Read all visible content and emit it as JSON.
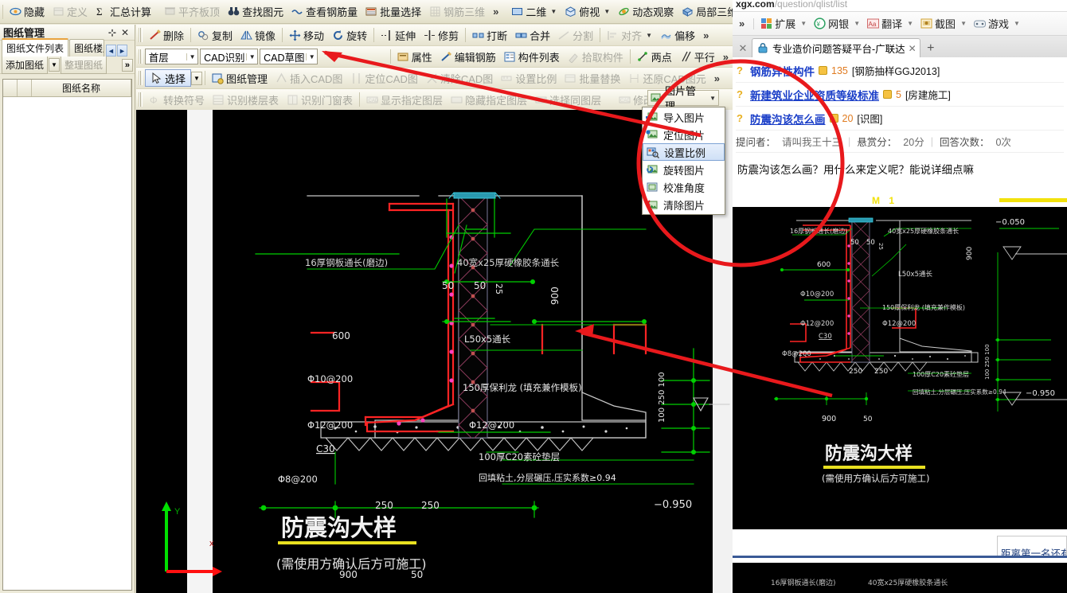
{
  "app": {
    "ribbon_top": [
      {
        "label": "隐藏",
        "icon": "eye-icon",
        "disabled": false
      },
      {
        "label": "定义",
        "icon": "define-icon",
        "disabled": true
      },
      {
        "label": "汇总计算",
        "icon": "sigma-icon",
        "disabled": false
      },
      {
        "label": "平齐板顶",
        "icon": "align-slab-icon",
        "disabled": true
      },
      {
        "label": "查找图元",
        "icon": "binoculars-icon",
        "disabled": false
      },
      {
        "label": "查看钢筋量",
        "icon": "rebar-qty-icon",
        "disabled": false
      },
      {
        "label": "批量选择",
        "icon": "batch-select-icon",
        "disabled": false
      },
      {
        "label": "钢筋三维",
        "icon": "rebar-3d-icon",
        "disabled": true
      }
    ],
    "ribbon_top_right": [
      {
        "label": "二维",
        "icon": "view-2d-icon",
        "caret": true
      },
      {
        "label": "俯视",
        "icon": "top-view-icon",
        "caret": true
      },
      {
        "label": "动态观察",
        "icon": "orbit-icon",
        "caret": false
      },
      {
        "label": "局部三维",
        "icon": "local-3d-icon",
        "caret": false
      }
    ],
    "toolbar_row1": [
      {
        "label": "删除",
        "icon": "delete-icon",
        "disabled": false
      },
      {
        "label": "复制",
        "icon": "copy-icon",
        "disabled": false
      },
      {
        "label": "镜像",
        "icon": "mirror-icon",
        "disabled": false
      },
      {
        "label": "移动",
        "icon": "move-icon",
        "disabled": false
      },
      {
        "label": "旋转",
        "icon": "rotate-icon",
        "disabled": false
      },
      {
        "label": "延伸",
        "icon": "extend-icon",
        "disabled": false
      },
      {
        "label": "修剪",
        "icon": "trim-icon",
        "disabled": false
      },
      {
        "label": "打断",
        "icon": "break-icon",
        "disabled": false
      },
      {
        "label": "合并",
        "icon": "merge-icon",
        "disabled": false
      },
      {
        "label": "分割",
        "icon": "split-icon",
        "disabled": true
      },
      {
        "label": "对齐",
        "icon": "align-icon",
        "disabled": true,
        "caret": true
      },
      {
        "label": "偏移",
        "icon": "offset-icon",
        "disabled": false
      }
    ],
    "toolbar_row2_combos": [
      {
        "value": "首层"
      },
      {
        "value": "CAD识别"
      },
      {
        "value": "CAD草图"
      }
    ],
    "toolbar_row2": [
      {
        "label": "属性",
        "icon": "properties-icon",
        "disabled": false
      },
      {
        "label": "编辑钢筋",
        "icon": "edit-rebar-icon",
        "disabled": false
      },
      {
        "label": "构件列表",
        "icon": "component-list-icon",
        "disabled": false
      },
      {
        "label": "拾取构件",
        "icon": "pick-component-icon",
        "disabled": true
      },
      {
        "label": "两点",
        "icon": "two-point-icon",
        "disabled": false
      },
      {
        "label": "平行",
        "icon": "parallel-icon",
        "disabled": false
      }
    ],
    "toolbar_row3_select": {
      "label": "选择",
      "icon": "arrow-select-icon"
    },
    "toolbar_row3": [
      {
        "label": "图纸管理",
        "icon": "drawing-manage-icon",
        "disabled": false
      },
      {
        "label": "插入CAD图",
        "icon": "insert-cad-icon",
        "disabled": true
      },
      {
        "label": "定位CAD图",
        "icon": "locate-cad-icon",
        "disabled": true
      },
      {
        "label": "清除CAD图",
        "icon": "clear-cad-icon",
        "disabled": true
      },
      {
        "label": "设置比例",
        "icon": "set-scale-icon",
        "disabled": true
      },
      {
        "label": "批量替换",
        "icon": "batch-replace-icon",
        "disabled": true
      },
      {
        "label": "还原CAD图元",
        "icon": "restore-cad-icon",
        "disabled": true
      }
    ],
    "toolbar_row4": [
      {
        "label": "转换符号",
        "icon": "convert-symbol-icon",
        "disabled": true
      },
      {
        "label": "识别楼层表",
        "icon": "recognize-floor-table-icon",
        "disabled": true
      },
      {
        "label": "识别门窗表",
        "icon": "recognize-door-window-icon",
        "disabled": true
      },
      {
        "label": "显示指定图层",
        "icon": "show-layer-icon",
        "disabled": true
      },
      {
        "label": "隐藏指定图层",
        "icon": "hide-layer-icon",
        "disabled": true
      },
      {
        "label": "选择同图层",
        "icon": "select-same-layer-icon",
        "disabled": true
      },
      {
        "label": "修改CAD标注",
        "icon": "modify-cad-dim-icon",
        "disabled": true
      }
    ],
    "picture_manage": {
      "button_label": "图片管理",
      "menu": [
        {
          "label": "导入图片",
          "icon": "import-image-icon",
          "highlighted": false
        },
        {
          "label": "定位图片",
          "icon": "locate-image-icon",
          "highlighted": false
        },
        {
          "label": "设置比例",
          "icon": "set-scale-image-icon",
          "highlighted": true
        },
        {
          "label": "旋转图片",
          "icon": "rotate-image-icon",
          "highlighted": false
        },
        {
          "label": "校准角度",
          "icon": "calibrate-angle-icon",
          "highlighted": false
        },
        {
          "label": "清除图片",
          "icon": "clear-image-icon",
          "highlighted": false
        }
      ]
    },
    "dock": {
      "title": "图纸管理",
      "pin_icon": "pin-icon",
      "close_icon": "close-icon",
      "tabs": [
        {
          "label": "图纸文件列表",
          "active": true
        },
        {
          "label": "图纸楼层",
          "active": false
        }
      ],
      "nav_prev": "◄",
      "nav_next": "►",
      "buttons": [
        {
          "label": "添加图纸",
          "disabled": false,
          "caret": true
        },
        {
          "label": "整理图纸",
          "disabled": true,
          "caret": false
        }
      ],
      "more_label": "»",
      "grid_header": "图纸名称"
    }
  },
  "cad": {
    "title": "防震沟大样",
    "subtitle": "(需使用方确认后方可施工)",
    "annotations": [
      {
        "text": "16厚钢板通长(磨边)"
      },
      {
        "text": "40宽x25厚硬橡胶条通长"
      },
      {
        "text": "50"
      },
      {
        "text": "50"
      },
      {
        "text": "25"
      },
      {
        "text": "600"
      },
      {
        "text": "L50x5通长"
      },
      {
        "text": "Φ10@200"
      },
      {
        "text": "150厚保利龙 (填充兼作模板)"
      },
      {
        "text": "Φ12@200"
      },
      {
        "text": "Φ12@200"
      },
      {
        "text": "C30"
      },
      {
        "text": "900"
      },
      {
        "text": "Φ8@200"
      },
      {
        "text": "250"
      },
      {
        "text": "250"
      },
      {
        "text": "900"
      },
      {
        "text": "50"
      },
      {
        "text": "100 250 100"
      },
      {
        "text": "-0.950"
      },
      {
        "text": "-0.050"
      },
      {
        "text": "100厚C20素砼垫层"
      },
      {
        "text": "回填粘土,分层碾压,压实系数≥0.94"
      }
    ],
    "axis": {
      "x_label": "x",
      "y_label": "Y"
    }
  },
  "browser": {
    "url_host": "xgx.com",
    "url_rest": "/question/qlist/list",
    "toolbar": [
      {
        "label": "扩展",
        "icon": "extension-icon",
        "caret": true
      },
      {
        "label": "网银",
        "icon": "bank-icon",
        "caret": true
      },
      {
        "label": "翻译",
        "icon": "translate-icon",
        "caret": true
      },
      {
        "label": "截图",
        "icon": "screenshot-icon",
        "caret": true
      },
      {
        "label": "游戏",
        "icon": "game-icon",
        "caret": true
      }
    ],
    "overflow_label": "»",
    "tab": {
      "title": "专业造价问题答疑平台-广联达",
      "icon": "lock-icon",
      "close_icon": "close-icon"
    },
    "new_tab_label": "+",
    "questions": [
      {
        "title": "钢筋异性构件",
        "coins": "135",
        "category": "[钢筋抽样GGJ2013]",
        "underline": false
      },
      {
        "title": "新建筑业企业资质等级标准",
        "coins": "5",
        "category": "[房建施工]",
        "underline": true
      },
      {
        "title": "防震沟该怎么画",
        "coins": "20",
        "category": "[识图]",
        "underline": true
      }
    ],
    "meta": {
      "asker_label": "提问者：",
      "asker": "请叫我王十三",
      "bounty_label": "悬赏分：",
      "bounty": "20分",
      "answers_label": "回答次数：",
      "answers": "0次"
    },
    "question_text": "防震沟该怎么画？用什么来定义呢？能说详细点嘛",
    "image_watermark": "M 1",
    "footer_text": "距离第一名还有"
  },
  "colors": {
    "cad_background": "#000000",
    "annotation_red": "#e8191c",
    "dim_green": "#00d000",
    "rebar_red": "#ff2020",
    "outline_white": "#d8d8d8",
    "title_yellow": "#e8e020",
    "highlight_blue": "#cfe0f6"
  }
}
